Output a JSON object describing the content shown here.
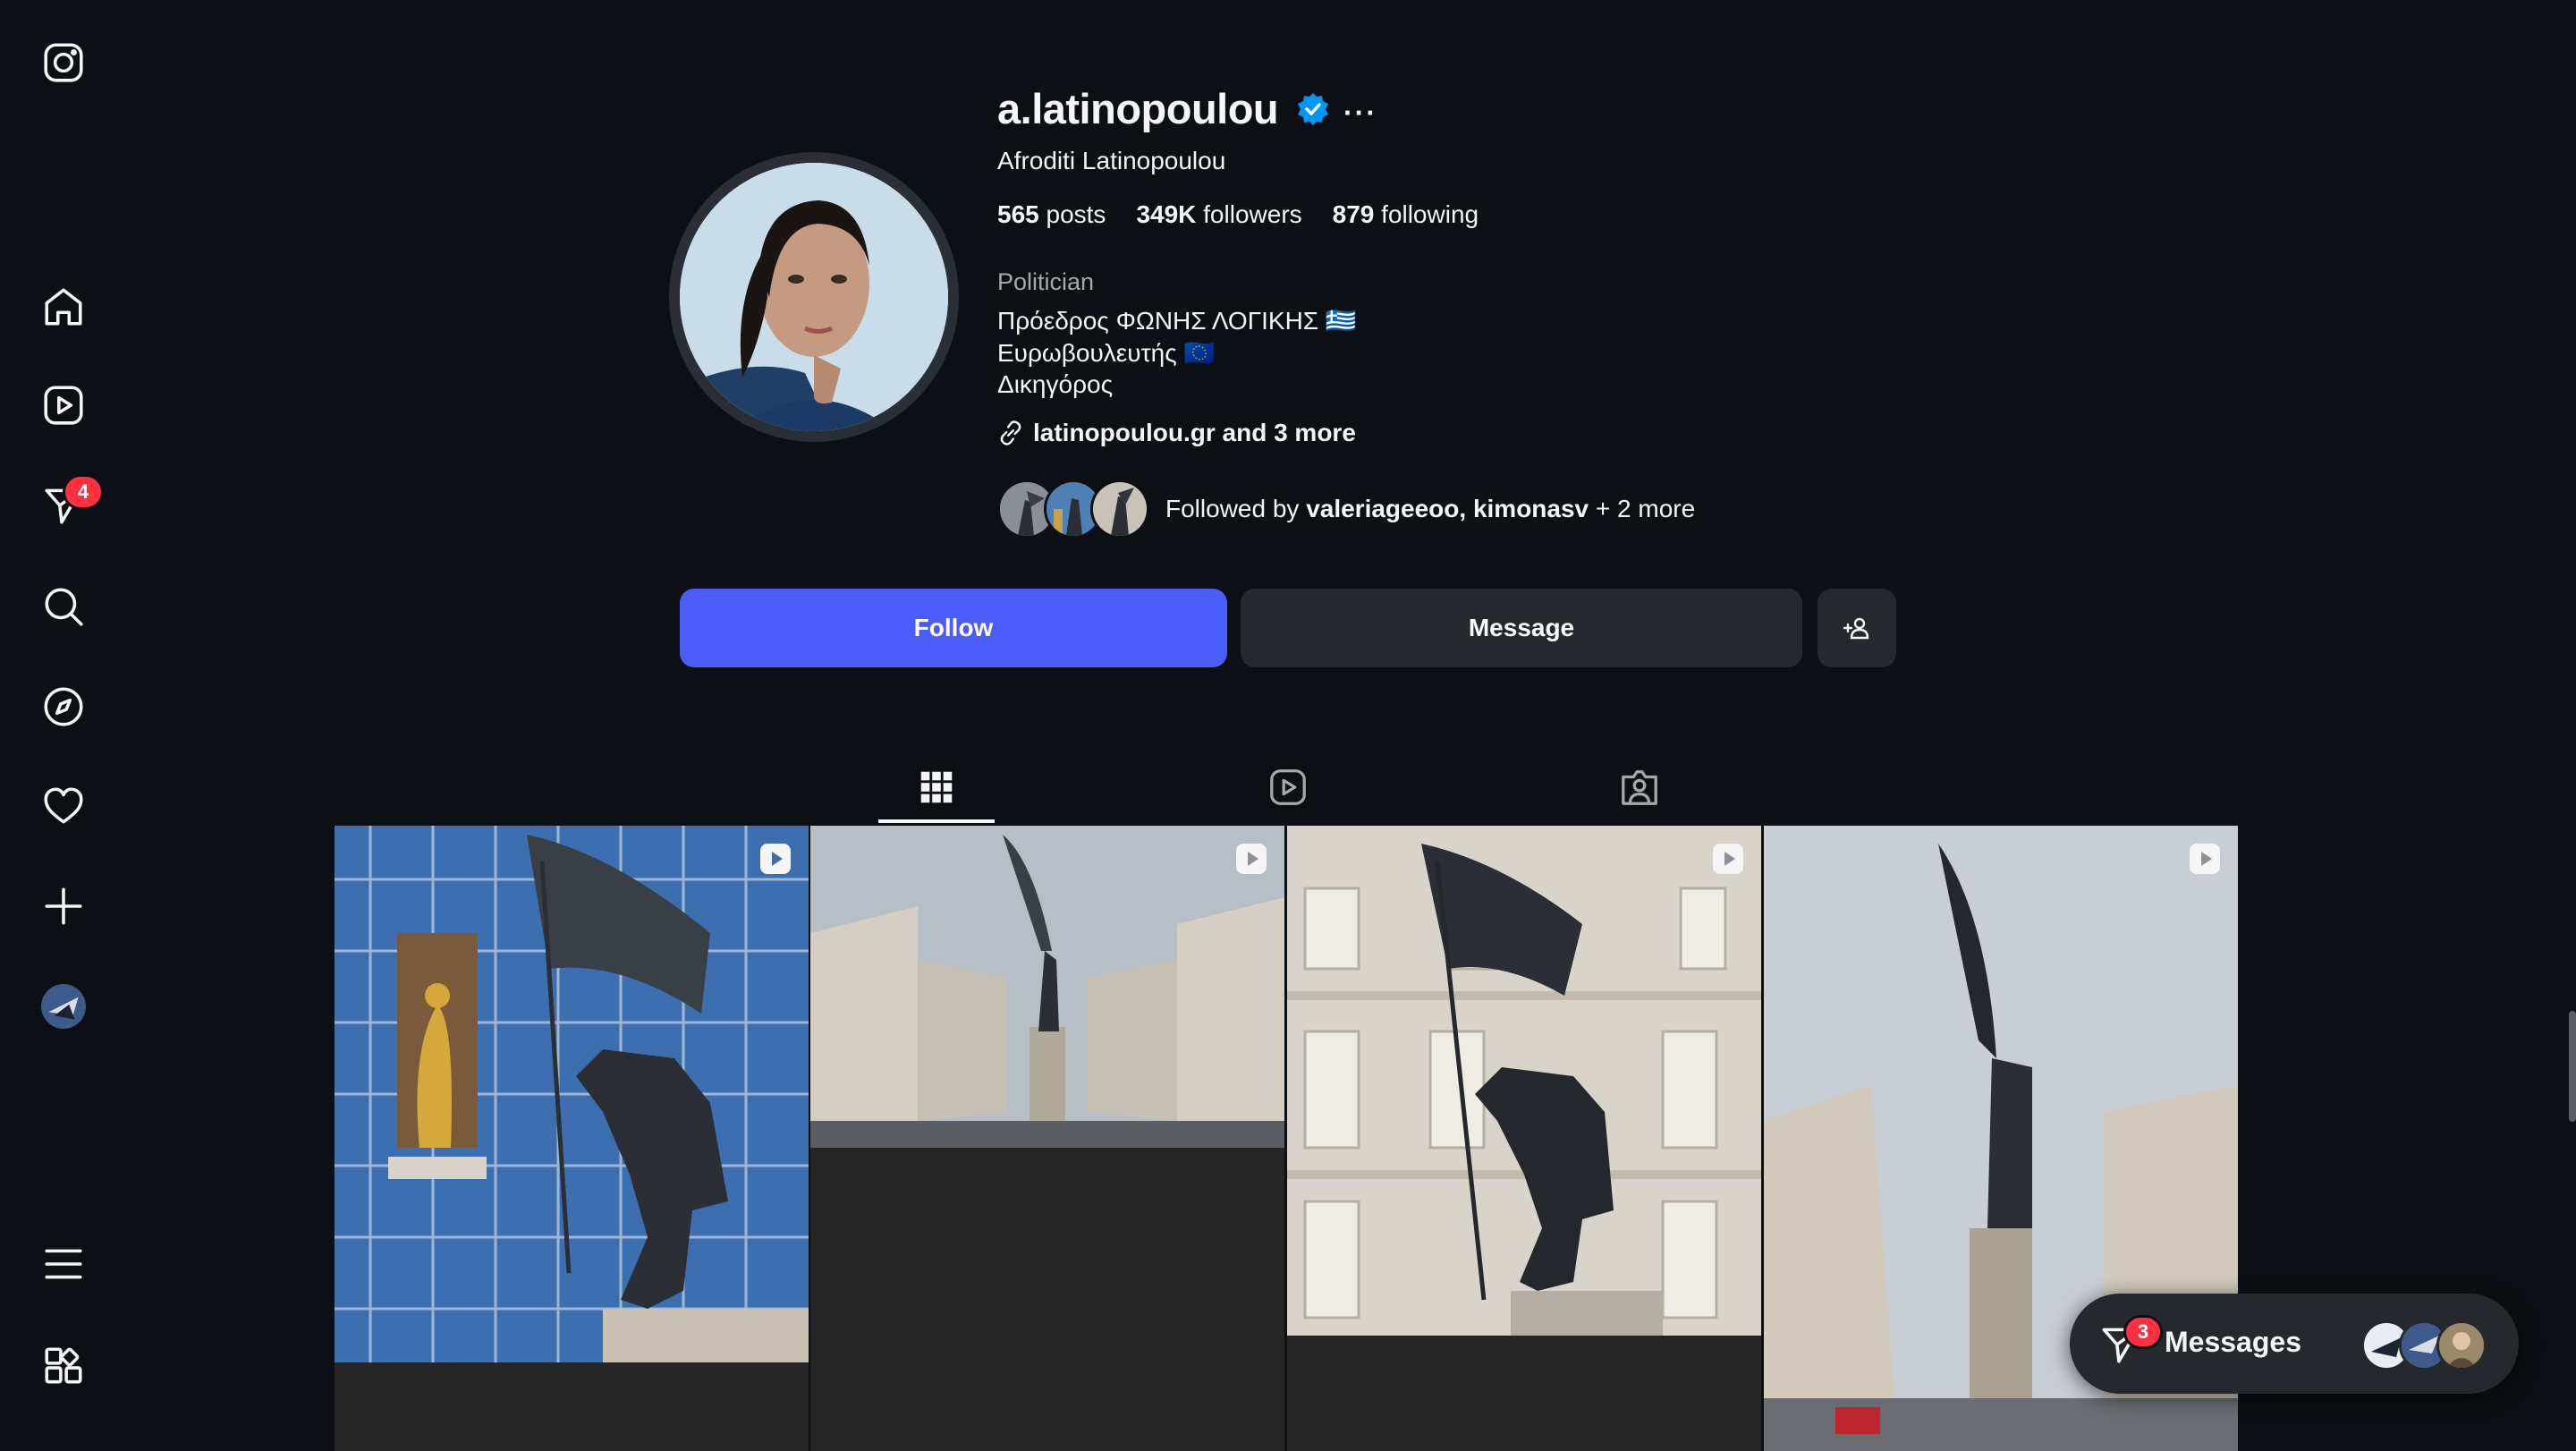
{
  "profile": {
    "username": "a.latinopoulou",
    "full_name": "Afroditi Latinopoulou",
    "stats": {
      "posts_count": "565",
      "posts_label": "posts",
      "followers_count": "349K",
      "followers_label": "followers",
      "following_count": "879",
      "following_label": "following"
    },
    "category": "Politician",
    "bio_lines": [
      "Πρόεδρος ΦΩΝΗΣ ΛΟΓΙΚΗΣ 🇬🇷",
      "Ευρωβουλευτής 🇪🇺",
      "Δικηγόρος"
    ],
    "link_text": "latinopoulou.gr and 3 more",
    "followed_by": {
      "prefix": "Followed by",
      "names": "valeriageeoo, kimonasv",
      "suffix": "+ 2 more"
    }
  },
  "actions": {
    "follow_label": "Follow",
    "message_label": "Message"
  },
  "sidebar": {
    "notification_badge": "4"
  },
  "messages_bar": {
    "label": "Messages",
    "badge": "3"
  },
  "colors": {
    "background": "#0c1014",
    "follow_button": "#4a5df9",
    "secondary_button": "#25292e",
    "badge": "#ff3040",
    "verified": "#0095f6"
  },
  "icons": [
    "instagram-logo-icon",
    "home-icon",
    "reels-icon",
    "messenger-icon",
    "search-icon",
    "explore-icon",
    "heart-icon",
    "create-icon",
    "profile-avatar",
    "menu-icon",
    "apps-icon",
    "verified-icon",
    "link-icon",
    "add-person-icon",
    "grid-icon",
    "reels-tab-icon",
    "tagged-icon",
    "reel-indicator-icon"
  ]
}
